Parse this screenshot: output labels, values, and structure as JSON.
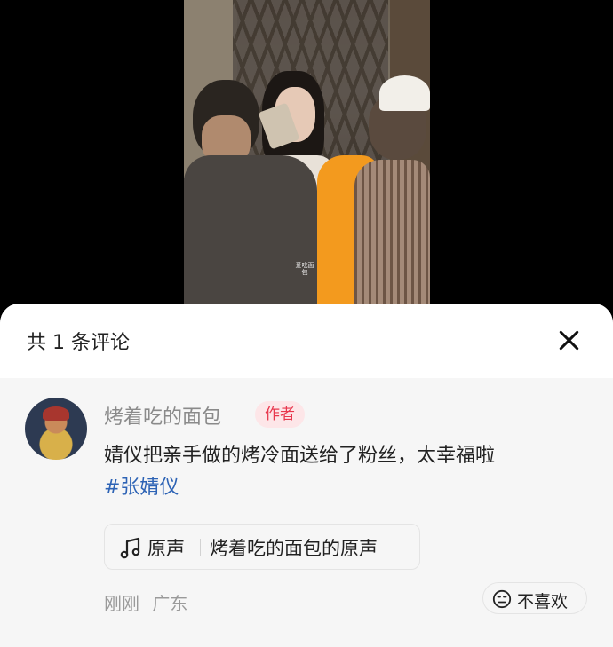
{
  "video": {
    "watermark": "爱吃面包"
  },
  "sheet": {
    "title": "共 1 条评论",
    "close_icon": "close-icon"
  },
  "comment": {
    "author": "烤着吃的面包",
    "badge": "作者",
    "text": "婧仪把亲手做的烤冷面送给了粉丝，太幸福啦",
    "hashtag": "#张婧仪",
    "sound": {
      "label": "原声",
      "title": "烤着吃的面包的原声",
      "icon": "music-note-icon"
    },
    "time": "刚刚",
    "location": "广东",
    "dislike_label": "不喜欢",
    "dislike_icon": "meh-face-icon"
  },
  "colors": {
    "hashtag": "#2d63b5",
    "badge_text": "#e8374d",
    "badge_bg": "#fde6e8"
  }
}
